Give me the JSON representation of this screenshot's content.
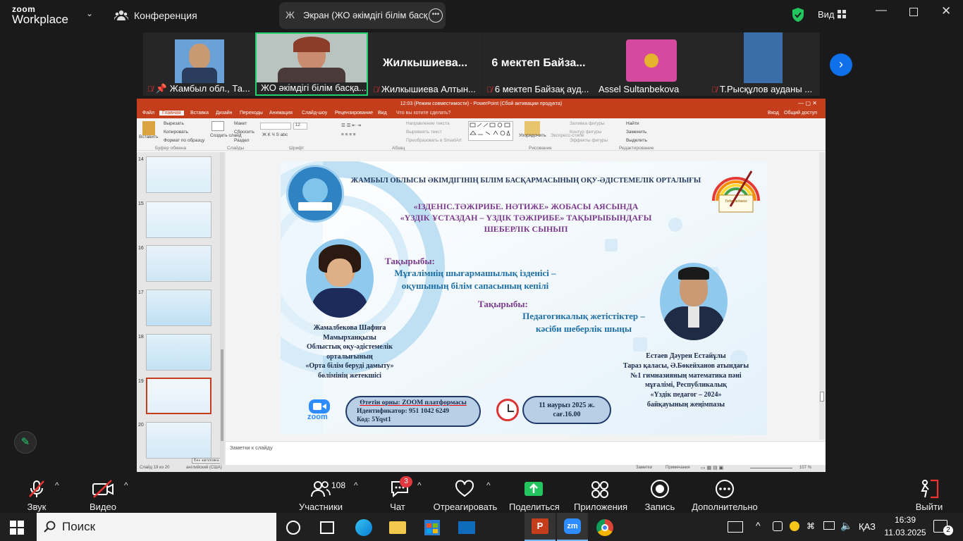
{
  "zoom": {
    "logo_top": "zoom",
    "logo_bottom": "Workplace",
    "conference_label": "Конференция",
    "share_initial": "Ж",
    "share_label": "Экран (ЖО әкімдігі білім басқ",
    "view_label": "Вид",
    "participants_count": "108",
    "chat_badge": "3"
  },
  "gallery": [
    {
      "name": "Жамбыл обл., Та...",
      "pinned": true,
      "mic_off": true
    },
    {
      "name": "ЖО әкімдігі білім басқа...",
      "active": true,
      "mic_off": false
    },
    {
      "name": "Жилкышиева   Алтын...",
      "big": "Жилкышиева...",
      "mic_off": true
    },
    {
      "name": "6 мектеп Байзақ ауд...",
      "big": "6 мектеп Байза...",
      "mic_off": true
    },
    {
      "name": "Assel Sultanbekova",
      "mic_off": false
    },
    {
      "name": "Т.Рысқұлов ауданы ...",
      "mic_off": true
    }
  ],
  "ppt": {
    "title": "12:03 (Режим совместимости) - PowerPoint (Сбой активации продукта)",
    "tabs": [
      "Файл",
      "Главная",
      "Вставка",
      "Дизайн",
      "Переходы",
      "Анимация",
      "Слайд-шоу",
      "Рецензирование",
      "Вид",
      "Что вы хотите сделать?"
    ],
    "signin": "Вход",
    "share": "Общий доступ",
    "ribbon": {
      "paste": "Вставить",
      "cut": "Вырезать",
      "copy": "Копировать",
      "format_painter": "Формат по образцу",
      "clipboard": "Буфер обмена",
      "create_slide": "Создать слайд",
      "layout": "Макет",
      "reset": "Сбросить",
      "section": "Раздел",
      "slides_group": "Слайды",
      "font_group": "Шрифт",
      "font_size": "12",
      "paragraph_group": "Абзац",
      "text_direction": "Направление текста",
      "align_text": "Выровнять текст",
      "smartart": "Преобразовать в SmartArt",
      "arrange": "Упорядочить",
      "quick_styles": "Экспресс-стили",
      "fill": "Заливка фигуры",
      "outline": "Контур фигуры",
      "effects": "Эффекты фигуры",
      "drawing_group": "Рисование",
      "find": "Найти",
      "replace": "Заменить",
      "select": "Выделить",
      "editing_group": "Редактирование"
    },
    "thumb_numbers": [
      "14",
      "15",
      "16",
      "17",
      "18",
      "19",
      "20"
    ],
    "tooltip": "Без заголовка",
    "notes_placeholder": "Заметки к слайду",
    "status_left": "Слайд 19 из 20",
    "status_lang": "английский (США)",
    "status_notes": "Заметки",
    "status_comments": "Примечания",
    "zoom_pct": "107 %"
  },
  "slide": {
    "header": "ЖАМБЫЛ ОБЛЫСЫ ӘКІМДІГІНІҢ БІЛІМ БАСҚАРМАСЫНЫҢ ОҚУ-ӘДІСТЕМЕЛІК ОРТАЛЫҒЫ",
    "project_line1": "«ІЗДЕНІС.ТӘЖІРИБЕ. НӘТИЖЕ» ЖОБАСЫ АЯСЫНДА",
    "project_line2": "«ҮЗДІК ҰСТАЗДАН – ҮЗДІК ТӘЖІРИБЕ» ТАҚЫРЫБЫНДАҒЫ",
    "project_line3": "ШЕБЕРЛІК СЫНЫП",
    "topic1_label": "Тақырыбы:",
    "topic1_line1": "Мұғалімнің шығармашылық ізденісі –",
    "topic1_line2": "оқушының білім сапасының кепілі",
    "topic2_label": "Тақырыбы:",
    "topic2_line1": "Педагогикалық жетістіктер –",
    "topic2_line2": "кәсіби шеберлік шыңы",
    "person1_lines": [
      "Жамалбекова Шафиға",
      "Мамырханқызы",
      "Облыстық оқу-әдістемелік",
      "орталығының",
      "«Орта білім беруді дамыту»",
      "бөлімінің жетекшісі"
    ],
    "person2_lines": [
      "Естаев Дәурен Естайұлы",
      "Тараз қаласы, Ә.Бөкейханов атындағы",
      "№1 гимназияның математика пәні",
      "мұғалімі, Республикалық",
      "«Үздік педагог – 2024»",
      "байқауының жеңімпазы"
    ],
    "zoom_info_line1": "Өтетін орны: ZOOM платформасы",
    "zoom_info_line2": "Идентификатор: 951 1042 6249",
    "zoom_info_line3": "Код: 5Yqst1",
    "date_line1": "11 наурыз 2025 ж.",
    "date_line2": "сағ.16.00",
    "zoom_logo": "zoom",
    "logo_right": "Үздік педагог"
  },
  "controls": {
    "audio": "Звук",
    "video": "Видео",
    "participants": "Участники",
    "chat": "Чат",
    "react": "Отреагировать",
    "share": "Поделиться",
    "apps": "Приложения",
    "record": "Запись",
    "more": "Дополнительно",
    "leave": "Выйти"
  },
  "taskbar": {
    "search_placeholder": "Поиск",
    "lang": "ҚАЗ",
    "time": "16:39",
    "date": "11.03.2025",
    "notif_count": "2"
  },
  "colors": {
    "zoom_blue": "#0e71eb",
    "active_green": "#22d16b",
    "ppt_red": "#c43e1c",
    "slide_blue": "#1e6fa6",
    "slide_purple": "#6a3d8f"
  }
}
